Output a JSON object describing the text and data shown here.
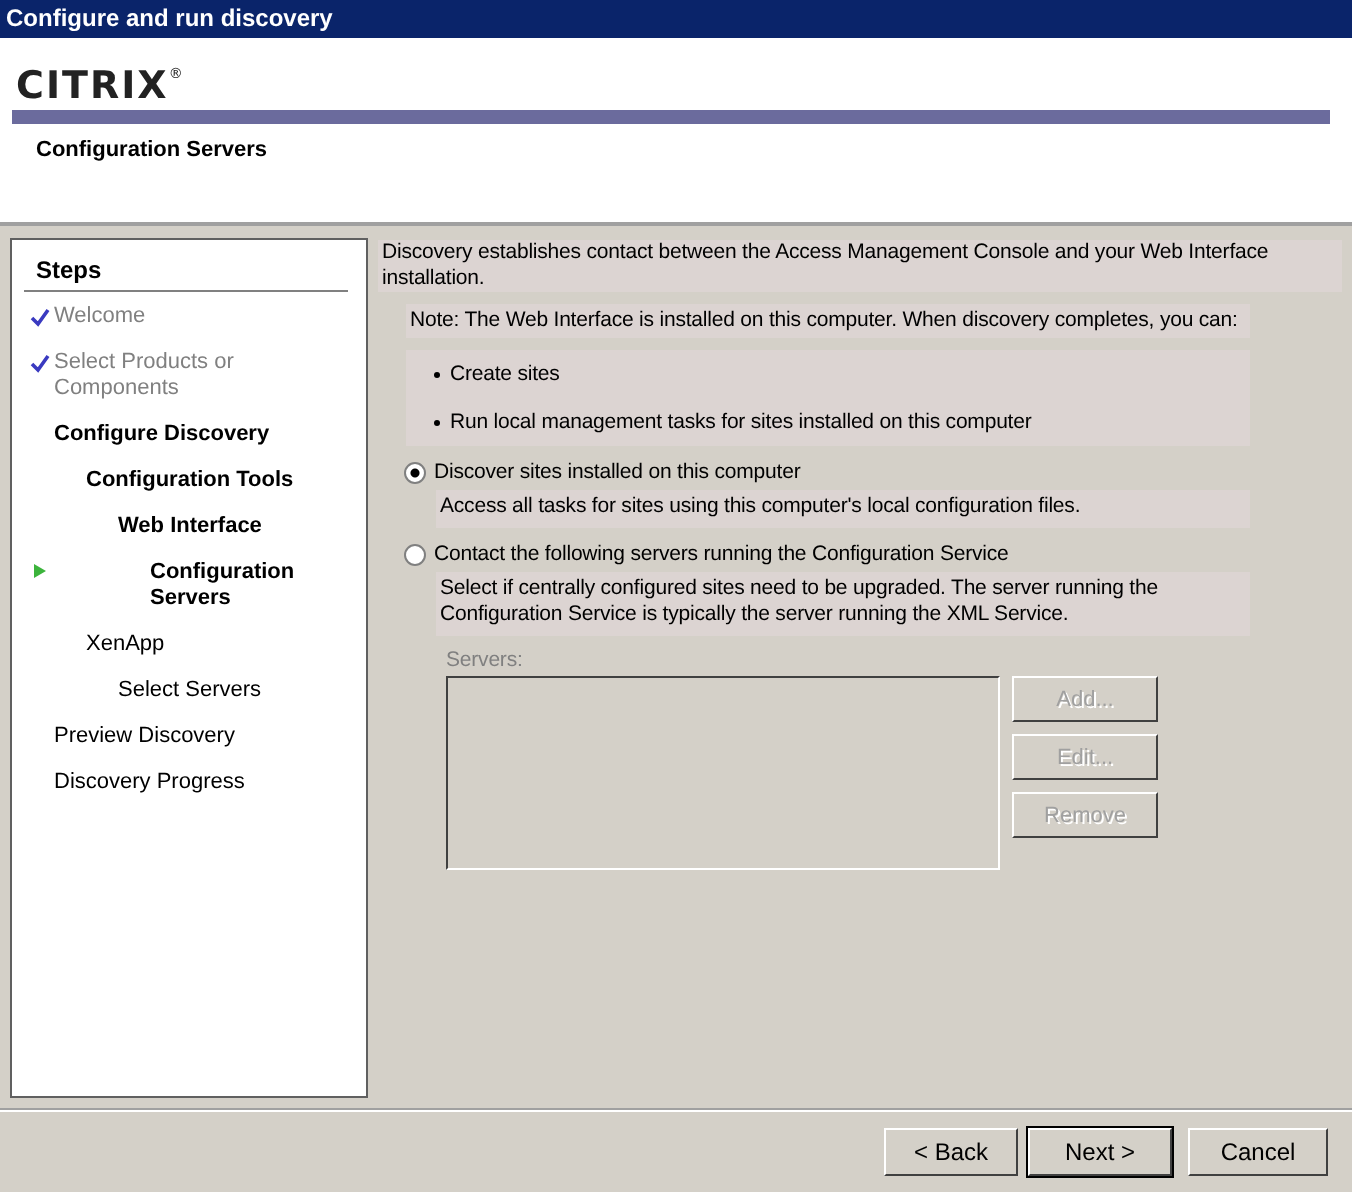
{
  "window": {
    "title": "Configure and run discovery"
  },
  "header": {
    "logo": "CITRIX$^{®}$",
    "subtitle": "Configuration Servers"
  },
  "steps": {
    "title": "Steps",
    "items": [
      {
        "label": "Welcome",
        "done": true,
        "current": false,
        "bold": false
      },
      {
        "label": "Select Products or Components",
        "done": true,
        "current": false,
        "bold": false
      },
      {
        "label": "Configure Discovery",
        "done": false,
        "current": false,
        "bold": true,
        "children": [
          {
            "label": "Configuration Tools",
            "done": false,
            "current": false,
            "bold": true,
            "children": [
              {
                "label": "Web Interface",
                "done": false,
                "current": false,
                "bold": true,
                "children": [
                  {
                    "label": "Configuration Servers",
                    "done": false,
                    "current": true,
                    "bold": true
                  }
                ]
              }
            ]
          },
          {
            "label": "XenApp",
            "done": false,
            "current": false,
            "bold": false,
            "children": [
              {
                "label": "Select Servers",
                "done": false,
                "current": false,
                "bold": false
              }
            ]
          }
        ]
      },
      {
        "label": "Preview Discovery",
        "done": false,
        "current": false,
        "bold": false
      },
      {
        "label": "Discovery Progress",
        "done": false,
        "current": false,
        "bold": false
      }
    ]
  },
  "content": {
    "intro": "Discovery establishes contact between the Access Management Console and your Web Interface installation.",
    "note": "Note: The Web Interface is installed on this computer. When discovery completes, you can:",
    "bullets": [
      "Create sites",
      "Run local management tasks for sites installed on this computer"
    ],
    "options": [
      {
        "label": "Discover sites installed on this computer",
        "description": "Access all tasks for sites using this computer's local configuration files.",
        "selected": true
      },
      {
        "label": "Contact the following servers running the Configuration Service",
        "description": "Select if centrally configured sites need to be upgraded. The server running the Configuration Service is typically the server running the XML Service.",
        "selected": false
      }
    ],
    "servers": {
      "label": "Servers:",
      "buttons": [
        {
          "label": "Add...",
          "disabled": true
        },
        {
          "label": "Edit...",
          "disabled": true
        },
        {
          "label": "Remove",
          "disabled": true
        }
      ]
    }
  },
  "footer": {
    "buttons": [
      {
        "label": "< Back",
        "default": false
      },
      {
        "label": "Next >",
        "default": true
      },
      {
        "label": "Cancel",
        "default": false
      }
    ]
  }
}
